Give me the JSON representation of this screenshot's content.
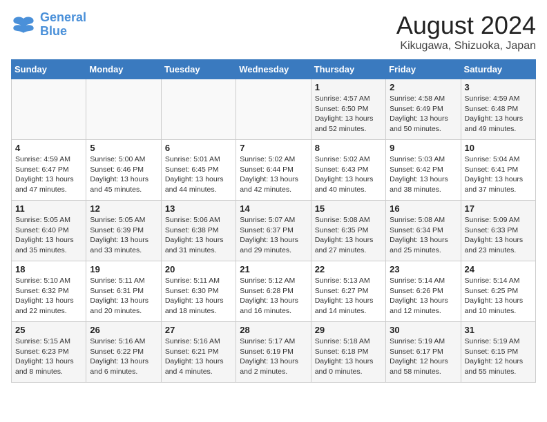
{
  "header": {
    "logo_line1": "General",
    "logo_line2": "Blue",
    "title": "August 2024",
    "subtitle": "Kikugawa, Shizuoka, Japan"
  },
  "weekdays": [
    "Sunday",
    "Monday",
    "Tuesday",
    "Wednesday",
    "Thursday",
    "Friday",
    "Saturday"
  ],
  "weeks": [
    [
      {
        "day": "",
        "info": ""
      },
      {
        "day": "",
        "info": ""
      },
      {
        "day": "",
        "info": ""
      },
      {
        "day": "",
        "info": ""
      },
      {
        "day": "1",
        "info": "Sunrise: 4:57 AM\nSunset: 6:50 PM\nDaylight: 13 hours\nand 52 minutes."
      },
      {
        "day": "2",
        "info": "Sunrise: 4:58 AM\nSunset: 6:49 PM\nDaylight: 13 hours\nand 50 minutes."
      },
      {
        "day": "3",
        "info": "Sunrise: 4:59 AM\nSunset: 6:48 PM\nDaylight: 13 hours\nand 49 minutes."
      }
    ],
    [
      {
        "day": "4",
        "info": "Sunrise: 4:59 AM\nSunset: 6:47 PM\nDaylight: 13 hours\nand 47 minutes."
      },
      {
        "day": "5",
        "info": "Sunrise: 5:00 AM\nSunset: 6:46 PM\nDaylight: 13 hours\nand 45 minutes."
      },
      {
        "day": "6",
        "info": "Sunrise: 5:01 AM\nSunset: 6:45 PM\nDaylight: 13 hours\nand 44 minutes."
      },
      {
        "day": "7",
        "info": "Sunrise: 5:02 AM\nSunset: 6:44 PM\nDaylight: 13 hours\nand 42 minutes."
      },
      {
        "day": "8",
        "info": "Sunrise: 5:02 AM\nSunset: 6:43 PM\nDaylight: 13 hours\nand 40 minutes."
      },
      {
        "day": "9",
        "info": "Sunrise: 5:03 AM\nSunset: 6:42 PM\nDaylight: 13 hours\nand 38 minutes."
      },
      {
        "day": "10",
        "info": "Sunrise: 5:04 AM\nSunset: 6:41 PM\nDaylight: 13 hours\nand 37 minutes."
      }
    ],
    [
      {
        "day": "11",
        "info": "Sunrise: 5:05 AM\nSunset: 6:40 PM\nDaylight: 13 hours\nand 35 minutes."
      },
      {
        "day": "12",
        "info": "Sunrise: 5:05 AM\nSunset: 6:39 PM\nDaylight: 13 hours\nand 33 minutes."
      },
      {
        "day": "13",
        "info": "Sunrise: 5:06 AM\nSunset: 6:38 PM\nDaylight: 13 hours\nand 31 minutes."
      },
      {
        "day": "14",
        "info": "Sunrise: 5:07 AM\nSunset: 6:37 PM\nDaylight: 13 hours\nand 29 minutes."
      },
      {
        "day": "15",
        "info": "Sunrise: 5:08 AM\nSunset: 6:35 PM\nDaylight: 13 hours\nand 27 minutes."
      },
      {
        "day": "16",
        "info": "Sunrise: 5:08 AM\nSunset: 6:34 PM\nDaylight: 13 hours\nand 25 minutes."
      },
      {
        "day": "17",
        "info": "Sunrise: 5:09 AM\nSunset: 6:33 PM\nDaylight: 13 hours\nand 23 minutes."
      }
    ],
    [
      {
        "day": "18",
        "info": "Sunrise: 5:10 AM\nSunset: 6:32 PM\nDaylight: 13 hours\nand 22 minutes."
      },
      {
        "day": "19",
        "info": "Sunrise: 5:11 AM\nSunset: 6:31 PM\nDaylight: 13 hours\nand 20 minutes."
      },
      {
        "day": "20",
        "info": "Sunrise: 5:11 AM\nSunset: 6:30 PM\nDaylight: 13 hours\nand 18 minutes."
      },
      {
        "day": "21",
        "info": "Sunrise: 5:12 AM\nSunset: 6:28 PM\nDaylight: 13 hours\nand 16 minutes."
      },
      {
        "day": "22",
        "info": "Sunrise: 5:13 AM\nSunset: 6:27 PM\nDaylight: 13 hours\nand 14 minutes."
      },
      {
        "day": "23",
        "info": "Sunrise: 5:14 AM\nSunset: 6:26 PM\nDaylight: 13 hours\nand 12 minutes."
      },
      {
        "day": "24",
        "info": "Sunrise: 5:14 AM\nSunset: 6:25 PM\nDaylight: 13 hours\nand 10 minutes."
      }
    ],
    [
      {
        "day": "25",
        "info": "Sunrise: 5:15 AM\nSunset: 6:23 PM\nDaylight: 13 hours\nand 8 minutes."
      },
      {
        "day": "26",
        "info": "Sunrise: 5:16 AM\nSunset: 6:22 PM\nDaylight: 13 hours\nand 6 minutes."
      },
      {
        "day": "27",
        "info": "Sunrise: 5:16 AM\nSunset: 6:21 PM\nDaylight: 13 hours\nand 4 minutes."
      },
      {
        "day": "28",
        "info": "Sunrise: 5:17 AM\nSunset: 6:19 PM\nDaylight: 13 hours\nand 2 minutes."
      },
      {
        "day": "29",
        "info": "Sunrise: 5:18 AM\nSunset: 6:18 PM\nDaylight: 13 hours\nand 0 minutes."
      },
      {
        "day": "30",
        "info": "Sunrise: 5:19 AM\nSunset: 6:17 PM\nDaylight: 12 hours\nand 58 minutes."
      },
      {
        "day": "31",
        "info": "Sunrise: 5:19 AM\nSunset: 6:15 PM\nDaylight: 12 hours\nand 55 minutes."
      }
    ]
  ]
}
